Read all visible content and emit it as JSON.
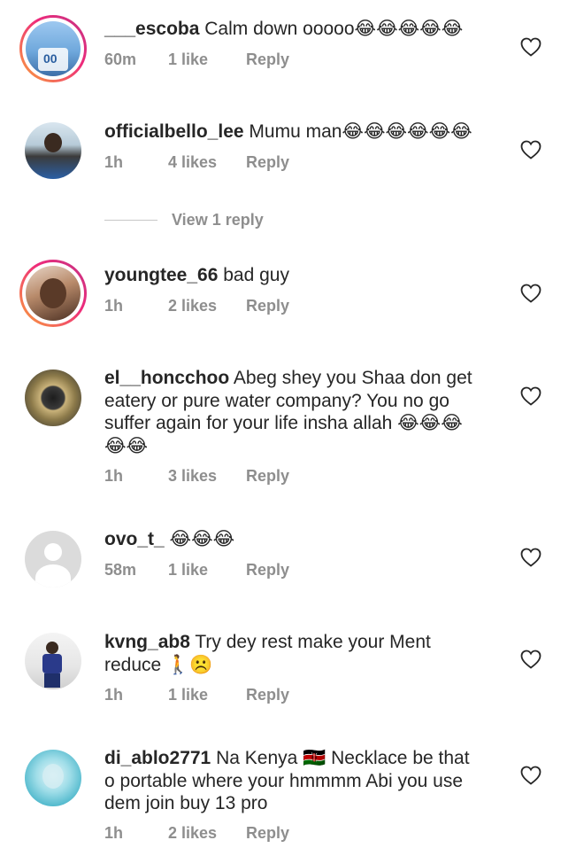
{
  "comments": [
    {
      "username": "___escoba",
      "text": "Calm down ooooo😂😂😂😂😂",
      "time": "60m",
      "likes": "1 like",
      "reply": "Reply"
    },
    {
      "username": "officialbello_lee",
      "text": "Mumu man😂😂😂😂😂😂",
      "time": "1h",
      "likes": "4 likes",
      "reply": "Reply"
    },
    {
      "username": "youngtee_66",
      "text": "bad guy",
      "time": "1h",
      "likes": "2 likes",
      "reply": "Reply"
    },
    {
      "username": "el__honcchoo",
      "text": "Abeg shey you Shaa don get eatery or pure water company? You no go suffer again for your life insha allah 😂😂😂 😂😂",
      "time": "1h",
      "likes": "3 likes",
      "reply": "Reply"
    },
    {
      "username": "ovo_t_",
      "text": "😂😂😂",
      "time": "58m",
      "likes": "1 like",
      "reply": "Reply"
    },
    {
      "username": "kvng_ab8",
      "text": "Try dey rest make your Ment reduce 🚶☹️",
      "time": "1h",
      "likes": "1 like",
      "reply": "Reply"
    },
    {
      "username": "di_ablo2771",
      "text": "Na Kenya 🇰🇪 Necklace be that o portable where your hmmmm Abi you use dem join buy 13 pro",
      "time": "1h",
      "likes": "2 likes",
      "reply": "Reply"
    }
  ],
  "view_replies": "View 1 reply",
  "icons": {
    "like": "heart-outline-icon",
    "default_avatar": "default-avatar-icon"
  },
  "colors": {
    "text": "#262626",
    "meta": "#8e8e8e",
    "story_ring_start": "#f9a23b",
    "story_ring_end": "#c13584"
  }
}
